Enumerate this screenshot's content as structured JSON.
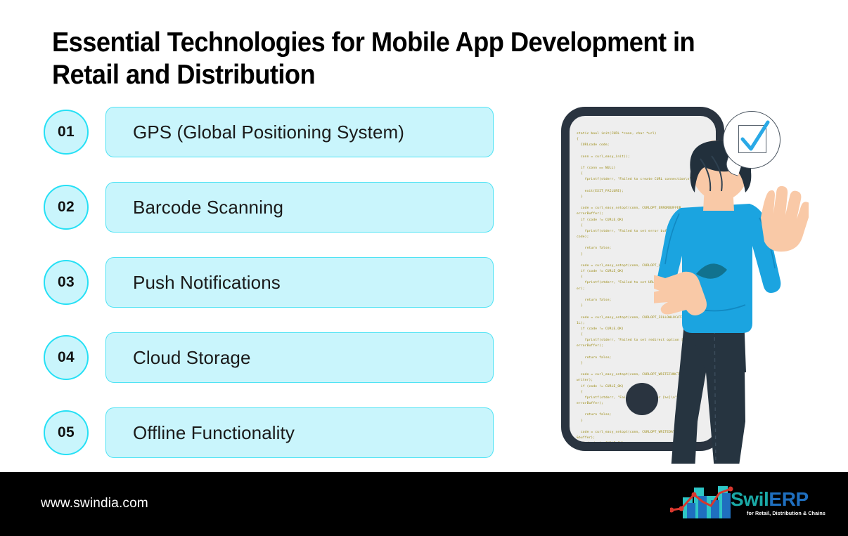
{
  "title": "Essential Technologies for Mobile App Development in Retail and Distribution",
  "list": {
    "items": [
      {
        "number": "01",
        "label": "GPS (Global Positioning System)"
      },
      {
        "number": "02",
        "label": "Barcode Scanning"
      },
      {
        "number": "03",
        "label": "Push Notifications"
      },
      {
        "number": "04",
        "label": "Cloud Storage"
      },
      {
        "number": "05",
        "label": "Offline Functionality"
      }
    ]
  },
  "illustration": {
    "device": "smartphone",
    "screen_code": "static bool init(CURL *conn, char *url)\n{\n  CURLcode code;\n\n  conn = curl_easy_init();\n\n  if (conn == NULL)\n  {\n    fprintf(stderr, \"Failed to create CURL connection\\n\");\n\n    exit(EXIT_FAILURE);\n  }\n\n  code = curl_easy_setopt(conn, CURLOPT_ERRORBUFFER,\nerrorBuffer);\n  if (code != CURLE_OK)\n  {\n    fprintf(stderr, \"Failed to set error buffer [%d]\\n\",\ncode);\n\n    return false;\n  }\n\n  code = curl_easy_setopt(conn, CURLOPT_URL, url);\n  if (code != CURLE_OK)\n  {\n    fprintf(stderr, \"Failed to set URL [%s]\\n\", errorBuff\ner);\n\n    return false;\n  }\n\n  code = curl_easy_setopt(conn, CURLOPT_FOLLOWLOCATION,\n1L);\n  if (code != CURLE_OK)\n  {\n    fprintf(stderr, \"Failed to set redirect option [%s]\\n\",\nerrorBuffer);\n\n    return false;\n  }\n\n  code = curl_easy_setopt(conn, CURLOPT_WRITEFUNCTION,\nwriter);\n  if (code != CURLE_OK)\n  {\n    fprintf(stderr, \"Failed to set writer [%s]\\n\",\nerrorBuffer);\n\n    return false;\n  }\n\n  code = curl_easy_setopt(conn, CURLOPT_WRITEDATA,\n&buffer);\n  if (code != CURLE_OK)\n  {\n    fprintf(stderr, \"Failed to set write data [%s]\\n\",\nerrorBuffer);\n\n  return true;",
    "speech_bubble": "checkbox with blue checkmark",
    "person": "person viewed from behind pointing at phone screen"
  },
  "footer": {
    "url": "www.swindia.com",
    "logo": {
      "name_primary": "Swil",
      "name_secondary": "ERP",
      "tagline": "for Retail, Distribution & Chains"
    }
  },
  "colors": {
    "box_fill": "#c9f5fc",
    "box_border": "#4fe3f4",
    "circle_border": "#25e0f5",
    "footer_bg": "#000000",
    "phone_frame": "#2a3440",
    "code_text": "#9a8a12",
    "shirt": "#1ba4e0",
    "jeans": "#263440",
    "shoes": "#29b6e8",
    "hair": "#22303c",
    "skin": "#f9c9a7",
    "check": "#2aa9e6",
    "logo_swil": "#1aa9a6",
    "logo_erp": "#1f6fbf",
    "logo_line": "#d9372e"
  }
}
